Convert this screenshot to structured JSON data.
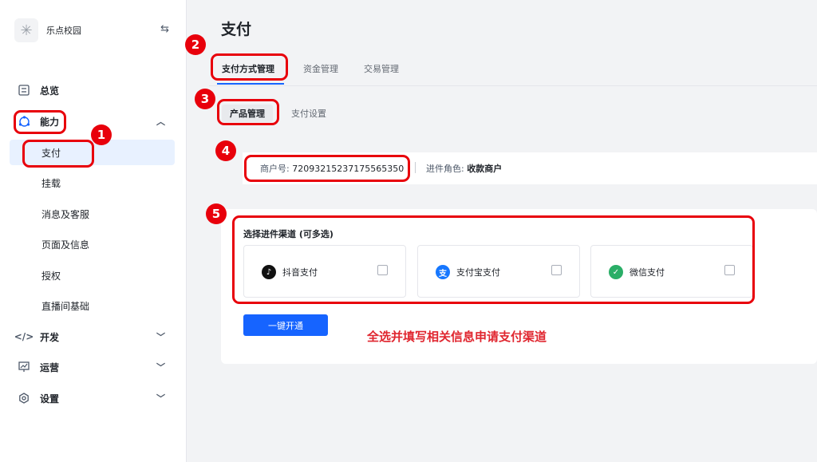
{
  "app": {
    "name": "乐点校园",
    "logo_icon": "sparkle-icon",
    "switch_icon": "swap-icon"
  },
  "nav": {
    "overview": "总览",
    "capability": "能力",
    "sub": [
      "支付",
      "挂载",
      "消息及客服",
      "页面及信息",
      "授权",
      "直播间基础"
    ],
    "develop": "开发",
    "operate": "运营",
    "settings": "设置"
  },
  "page": {
    "title": "支付"
  },
  "tabs": [
    "支付方式管理",
    "资金管理",
    "交易管理"
  ],
  "subtabs": [
    "产品管理",
    "支付设置"
  ],
  "merchant": {
    "label": "商户号:",
    "number": "72093215237175565350"
  },
  "role": {
    "label": "进件角色:",
    "value": "收款商户"
  },
  "channels": {
    "title": "选择进件渠道 (可多选)",
    "items": [
      {
        "label": "抖音支付",
        "icon": "douyin-icon",
        "color": "#111111"
      },
      {
        "label": "支付宝支付",
        "icon": "alipay-icon",
        "color": "#1677ff"
      },
      {
        "label": "微信支付",
        "icon": "wechat-icon",
        "color": "#2aae67"
      }
    ]
  },
  "button": {
    "open": "一键开通"
  },
  "hint": "全选并填写相关信息申请支付渠道",
  "annotations": [
    "1",
    "2",
    "3",
    "4",
    "5"
  ],
  "colors": {
    "accent": "#1664ff",
    "annotation": "#e8000b",
    "hint": "#e0262f"
  }
}
